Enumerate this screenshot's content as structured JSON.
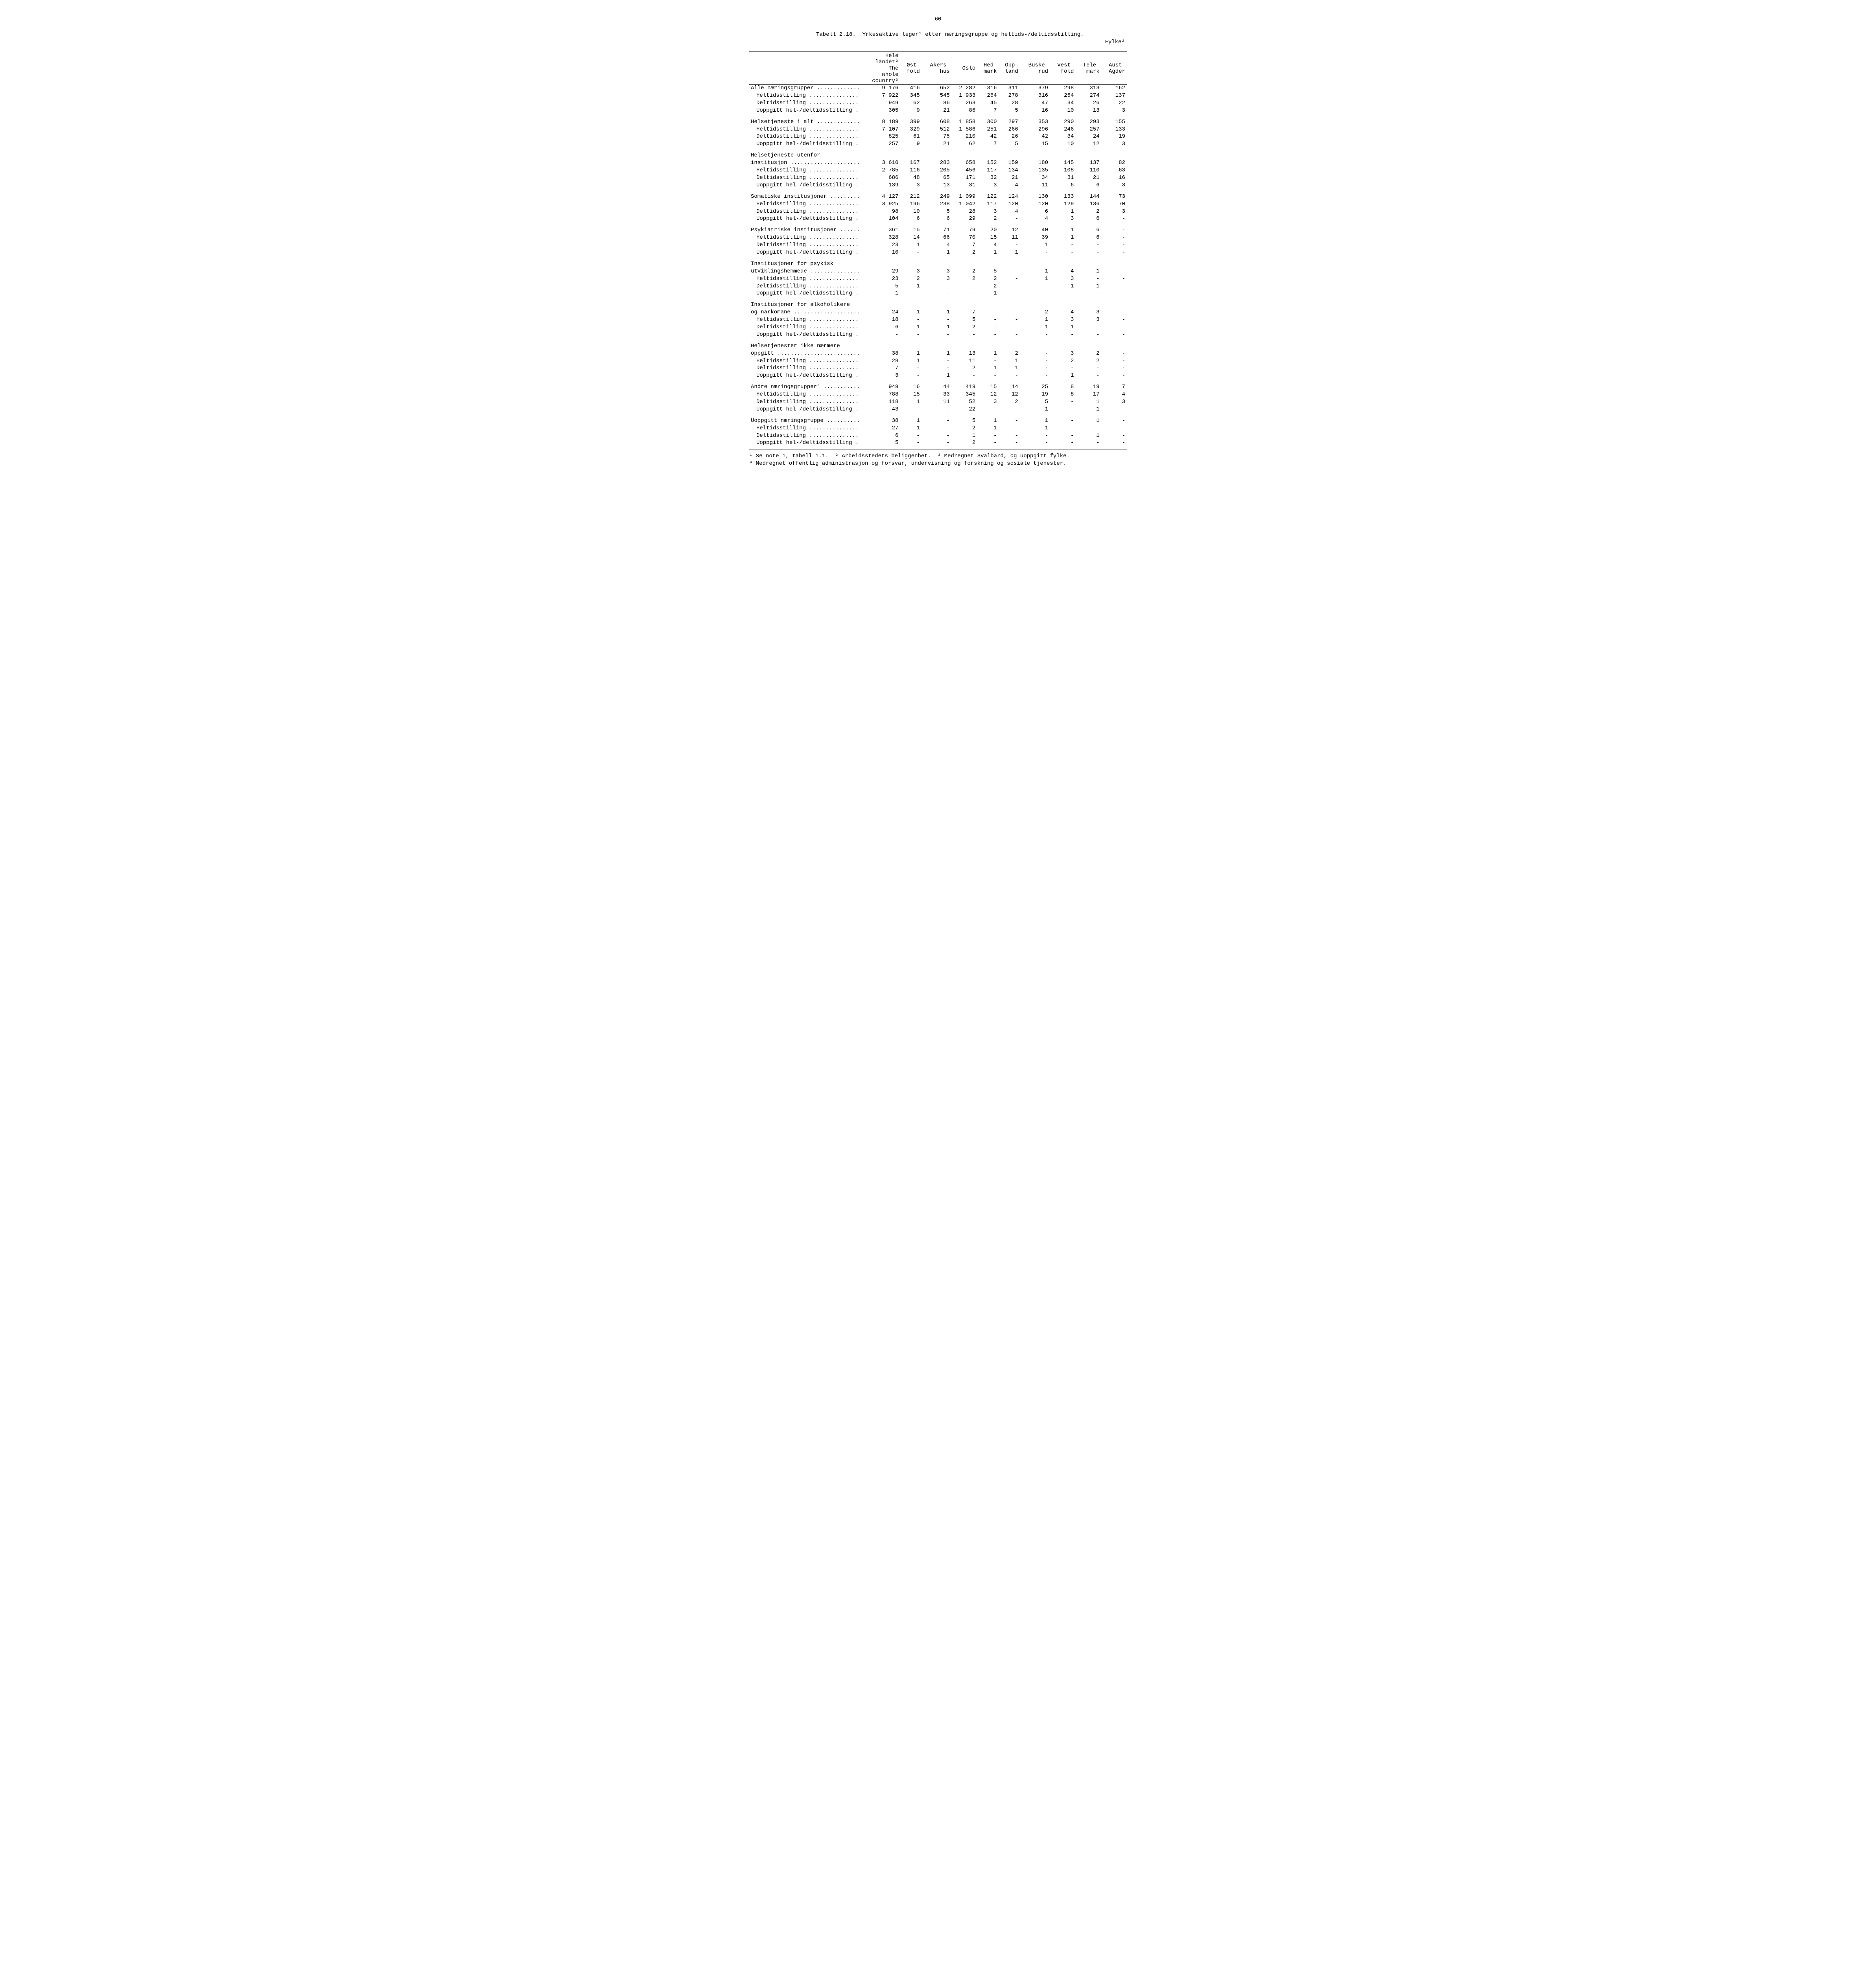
{
  "page_number": "60",
  "title_line1": "Tabell 2.18.  Yrkesaktive leger¹ etter næringsgruppe og heltids-/deltidsstilling.",
  "title_line2": "Fylke²",
  "columns": {
    "stub": "",
    "c1": [
      "Hele",
      "landet³",
      "The",
      "whole",
      "country³"
    ],
    "c2": [
      "Øst-",
      "fold"
    ],
    "c3": [
      "Akers-",
      "hus"
    ],
    "c4": [
      "Oslo"
    ],
    "c5": [
      "Hed-",
      "mark"
    ],
    "c6": [
      "Opp-",
      "land"
    ],
    "c7": [
      "Buske-",
      "rud"
    ],
    "c8": [
      "Vest-",
      "fold"
    ],
    "c9": [
      "Tele-",
      "mark"
    ],
    "c10": [
      "Aust-",
      "Agder"
    ]
  },
  "groups": [
    {
      "rows": [
        {
          "label": "Alle næringsgrupper .............",
          "v": [
            "9 176",
            "416",
            "652",
            "2 282",
            "316",
            "311",
            "379",
            "298",
            "313",
            "162"
          ]
        },
        {
          "label": "Heltidsstilling ...............",
          "indent": true,
          "v": [
            "7 922",
            "345",
            "545",
            "1 933",
            "264",
            "278",
            "316",
            "254",
            "274",
            "137"
          ]
        },
        {
          "label": "Deltidsstilling ...............",
          "indent": true,
          "v": [
            "949",
            "62",
            "86",
            "263",
            "45",
            "28",
            "47",
            "34",
            "26",
            "22"
          ]
        },
        {
          "label": "Uoppgitt hel-/deltidsstilling .",
          "indent": true,
          "v": [
            "305",
            "9",
            "21",
            "86",
            "7",
            "5",
            "16",
            "10",
            "13",
            "3"
          ]
        }
      ]
    },
    {
      "rows": [
        {
          "label": "Helsetjeneste i alt .............",
          "v": [
            "8 189",
            "399",
            "608",
            "1 858",
            "300",
            "297",
            "353",
            "290",
            "293",
            "155"
          ]
        },
        {
          "label": "Heltidsstilling ...............",
          "indent": true,
          "v": [
            "7 107",
            "329",
            "512",
            "1 586",
            "251",
            "266",
            "296",
            "246",
            "257",
            "133"
          ]
        },
        {
          "label": "Deltidsstilling ...............",
          "indent": true,
          "v": [
            "825",
            "61",
            "75",
            "210",
            "42",
            "26",
            "42",
            "34",
            "24",
            "19"
          ]
        },
        {
          "label": "Uoppgitt hel-/deltidsstilling .",
          "indent": true,
          "v": [
            "257",
            "9",
            "21",
            "62",
            "7",
            "5",
            "15",
            "10",
            "12",
            "3"
          ]
        }
      ]
    },
    {
      "rows": [
        {
          "label": "Helsetjeneste utenfor",
          "v": [
            "",
            "",
            "",
            "",
            "",
            "",
            "",
            "",
            "",
            ""
          ]
        },
        {
          "label": "institusjon .....................",
          "v": [
            "3 610",
            "167",
            "283",
            "658",
            "152",
            "159",
            "180",
            "145",
            "137",
            "82"
          ]
        },
        {
          "label": "Heltidsstilling ...............",
          "indent": true,
          "v": [
            "2 785",
            "116",
            "205",
            "456",
            "117",
            "134",
            "135",
            "108",
            "110",
            "63"
          ]
        },
        {
          "label": "Deltidsstilling ...............",
          "indent": true,
          "v": [
            "686",
            "48",
            "65",
            "171",
            "32",
            "21",
            "34",
            "31",
            "21",
            "16"
          ]
        },
        {
          "label": "Uoppgitt hel-/deltidsstilling .",
          "indent": true,
          "v": [
            "139",
            "3",
            "13",
            "31",
            "3",
            "4",
            "11",
            "6",
            "6",
            "3"
          ]
        }
      ]
    },
    {
      "rows": [
        {
          "label": "Somatiske institusjoner .........",
          "v": [
            "4 127",
            "212",
            "249",
            "1 099",
            "122",
            "124",
            "130",
            "133",
            "144",
            "73"
          ]
        },
        {
          "label": "Heltidsstilling ...............",
          "indent": true,
          "v": [
            "3 925",
            "196",
            "238",
            "1 042",
            "117",
            "120",
            "120",
            "129",
            "136",
            "70"
          ]
        },
        {
          "label": "Deltidsstilling ...............",
          "indent": true,
          "v": [
            "98",
            "10",
            "5",
            "28",
            "3",
            "4",
            "6",
            "1",
            "2",
            "3"
          ]
        },
        {
          "label": "Uoppgitt hel-/deltidsstilling .",
          "indent": true,
          "v": [
            "104",
            "6",
            "6",
            "29",
            "2",
            "-",
            "4",
            "3",
            "6",
            "-"
          ]
        }
      ]
    },
    {
      "rows": [
        {
          "label": "Psykiatriske institusjoner ......",
          "v": [
            "361",
            "15",
            "71",
            "79",
            "20",
            "12",
            "40",
            "1",
            "6",
            "-"
          ]
        },
        {
          "label": "Heltidsstilling ...............",
          "indent": true,
          "v": [
            "328",
            "14",
            "66",
            "70",
            "15",
            "11",
            "39",
            "1",
            "6",
            "-"
          ]
        },
        {
          "label": "Deltidsstilling ...............",
          "indent": true,
          "v": [
            "23",
            "1",
            "4",
            "7",
            "4",
            "-",
            "1",
            "-",
            "-",
            "-"
          ]
        },
        {
          "label": "Uoppgitt hel-/deltidsstilling .",
          "indent": true,
          "v": [
            "10",
            "-",
            "1",
            "2",
            "1",
            "1",
            "-",
            "-",
            "-",
            "-"
          ]
        }
      ]
    },
    {
      "rows": [
        {
          "label": "Institusjoner for psykisk",
          "v": [
            "",
            "",
            "",
            "",
            "",
            "",
            "",
            "",
            "",
            ""
          ]
        },
        {
          "label": "utviklingshemmede ...............",
          "v": [
            "29",
            "3",
            "3",
            "2",
            "5",
            "-",
            "1",
            "4",
            "1",
            "-"
          ]
        },
        {
          "label": "Heltidsstilling ...............",
          "indent": true,
          "v": [
            "23",
            "2",
            "3",
            "2",
            "2",
            "-",
            "1",
            "3",
            "-",
            "-"
          ]
        },
        {
          "label": "Deltidsstilling ...............",
          "indent": true,
          "v": [
            "5",
            "1",
            "-",
            "-",
            "2",
            "-",
            "-",
            "1",
            "1",
            "-"
          ]
        },
        {
          "label": "Uoppgitt hel-/deltidsstilling .",
          "indent": true,
          "v": [
            "1",
            "-",
            "-",
            "-",
            "1",
            "-",
            "-",
            "-",
            "-",
            "-"
          ]
        }
      ]
    },
    {
      "rows": [
        {
          "label": "Institusjoner for alkoholikere",
          "v": [
            "",
            "",
            "",
            "",
            "",
            "",
            "",
            "",
            "",
            ""
          ]
        },
        {
          "label": "og narkomane ....................",
          "v": [
            "24",
            "1",
            "1",
            "7",
            "-",
            "-",
            "2",
            "4",
            "3",
            "-"
          ]
        },
        {
          "label": "Heltidsstilling ...............",
          "indent": true,
          "v": [
            "18",
            "-",
            "-",
            "5",
            "-",
            "-",
            "1",
            "3",
            "3",
            "-"
          ]
        },
        {
          "label": "Deltidsstilling ...............",
          "indent": true,
          "v": [
            "6",
            "1",
            "1",
            "2",
            "-",
            "-",
            "1",
            "1",
            "-",
            "-"
          ]
        },
        {
          "label": "Uoppgitt hel-/deltidsstilling .",
          "indent": true,
          "v": [
            "-",
            "-",
            "-",
            "-",
            "-",
            "-",
            "-",
            "-",
            "-",
            "-"
          ]
        }
      ]
    },
    {
      "rows": [
        {
          "label": "Helsetjenester ikke nærmere",
          "v": [
            "",
            "",
            "",
            "",
            "",
            "",
            "",
            "",
            "",
            ""
          ]
        },
        {
          "label": "oppgitt .........................",
          "v": [
            "38",
            "1",
            "1",
            "13",
            "1",
            "2",
            "-",
            "3",
            "2",
            "-"
          ]
        },
        {
          "label": "Heltidsstilling ...............",
          "indent": true,
          "v": [
            "28",
            "1",
            "-",
            "11",
            "-",
            "1",
            "-",
            "2",
            "2",
            "-"
          ]
        },
        {
          "label": "Deltidsstilling ...............",
          "indent": true,
          "v": [
            "7",
            "-",
            "-",
            "2",
            "1",
            "1",
            "-",
            "-",
            "-",
            "-"
          ]
        },
        {
          "label": "Uoppgitt hel-/deltidsstilling .",
          "indent": true,
          "v": [
            "3",
            "-",
            "1",
            "-",
            "-",
            "-",
            "-",
            "1",
            "-",
            "-"
          ]
        }
      ]
    },
    {
      "rows": [
        {
          "label": "Andre næringsgrupper⁴ ...........",
          "v": [
            "949",
            "16",
            "44",
            "419",
            "15",
            "14",
            "25",
            "8",
            "19",
            "7"
          ]
        },
        {
          "label": "Heltidsstilling ...............",
          "indent": true,
          "v": [
            "788",
            "15",
            "33",
            "345",
            "12",
            "12",
            "19",
            "8",
            "17",
            "4"
          ]
        },
        {
          "label": "Deltidsstilling ...............",
          "indent": true,
          "v": [
            "118",
            "1",
            "11",
            "52",
            "3",
            "2",
            "5",
            "-",
            "1",
            "3"
          ]
        },
        {
          "label": "Uoppgitt hel-/deltidsstilling .",
          "indent": true,
          "v": [
            "43",
            "-",
            "-",
            "22",
            "-",
            "-",
            "1",
            "-",
            "1",
            "-"
          ]
        }
      ]
    },
    {
      "rows": [
        {
          "label": "Uoppgitt næringsgruppe ..........",
          "v": [
            "38",
            "1",
            "-",
            "5",
            "1",
            "-",
            "1",
            "-",
            "1",
            "-"
          ]
        },
        {
          "label": "Heltidsstilling ...............",
          "indent": true,
          "v": [
            "27",
            "1",
            "-",
            "2",
            "1",
            "-",
            "1",
            "-",
            "-",
            "-"
          ]
        },
        {
          "label": "Deltidsstilling ...............",
          "indent": true,
          "v": [
            "6",
            "-",
            "-",
            "1",
            "-",
            "-",
            "-",
            "-",
            "1",
            "-"
          ]
        },
        {
          "label": "Uoppgitt hel-/deltidsstilling .",
          "indent": true,
          "v": [
            "5",
            "-",
            "-",
            "2",
            "-",
            "-",
            "-",
            "-",
            "-",
            "-"
          ]
        }
      ]
    }
  ],
  "footnotes": "¹ Se note 1, tabell 1.1.  ² Arbeidsstedets beliggenhet.  ³ Medregnet Svalbard, og uoppgitt fylke.\n⁴ Medregnet offentlig administrasjon og forsvar, undervisning og forskning og sosiale tjenester."
}
